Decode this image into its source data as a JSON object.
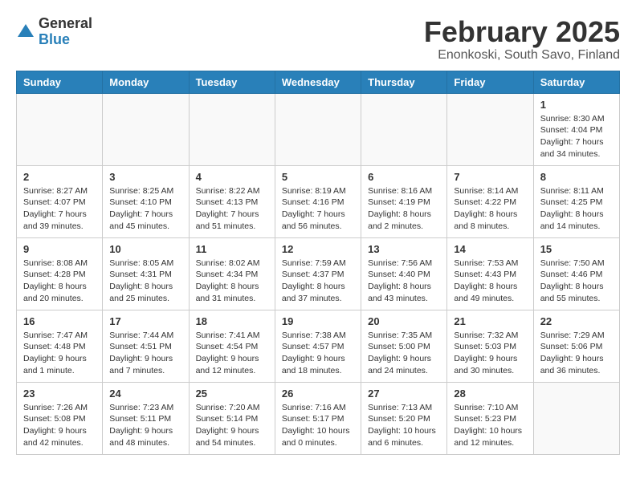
{
  "logo": {
    "general": "General",
    "blue": "Blue"
  },
  "title": "February 2025",
  "subtitle": "Enonkoski, South Savo, Finland",
  "weekdays": [
    "Sunday",
    "Monday",
    "Tuesday",
    "Wednesday",
    "Thursday",
    "Friday",
    "Saturday"
  ],
  "weeks": [
    [
      {
        "day": "",
        "info": ""
      },
      {
        "day": "",
        "info": ""
      },
      {
        "day": "",
        "info": ""
      },
      {
        "day": "",
        "info": ""
      },
      {
        "day": "",
        "info": ""
      },
      {
        "day": "",
        "info": ""
      },
      {
        "day": "1",
        "info": "Sunrise: 8:30 AM\nSunset: 4:04 PM\nDaylight: 7 hours\nand 34 minutes."
      }
    ],
    [
      {
        "day": "2",
        "info": "Sunrise: 8:27 AM\nSunset: 4:07 PM\nDaylight: 7 hours\nand 39 minutes."
      },
      {
        "day": "3",
        "info": "Sunrise: 8:25 AM\nSunset: 4:10 PM\nDaylight: 7 hours\nand 45 minutes."
      },
      {
        "day": "4",
        "info": "Sunrise: 8:22 AM\nSunset: 4:13 PM\nDaylight: 7 hours\nand 51 minutes."
      },
      {
        "day": "5",
        "info": "Sunrise: 8:19 AM\nSunset: 4:16 PM\nDaylight: 7 hours\nand 56 minutes."
      },
      {
        "day": "6",
        "info": "Sunrise: 8:16 AM\nSunset: 4:19 PM\nDaylight: 8 hours\nand 2 minutes."
      },
      {
        "day": "7",
        "info": "Sunrise: 8:14 AM\nSunset: 4:22 PM\nDaylight: 8 hours\nand 8 minutes."
      },
      {
        "day": "8",
        "info": "Sunrise: 8:11 AM\nSunset: 4:25 PM\nDaylight: 8 hours\nand 14 minutes."
      }
    ],
    [
      {
        "day": "9",
        "info": "Sunrise: 8:08 AM\nSunset: 4:28 PM\nDaylight: 8 hours\nand 20 minutes."
      },
      {
        "day": "10",
        "info": "Sunrise: 8:05 AM\nSunset: 4:31 PM\nDaylight: 8 hours\nand 25 minutes."
      },
      {
        "day": "11",
        "info": "Sunrise: 8:02 AM\nSunset: 4:34 PM\nDaylight: 8 hours\nand 31 minutes."
      },
      {
        "day": "12",
        "info": "Sunrise: 7:59 AM\nSunset: 4:37 PM\nDaylight: 8 hours\nand 37 minutes."
      },
      {
        "day": "13",
        "info": "Sunrise: 7:56 AM\nSunset: 4:40 PM\nDaylight: 8 hours\nand 43 minutes."
      },
      {
        "day": "14",
        "info": "Sunrise: 7:53 AM\nSunset: 4:43 PM\nDaylight: 8 hours\nand 49 minutes."
      },
      {
        "day": "15",
        "info": "Sunrise: 7:50 AM\nSunset: 4:46 PM\nDaylight: 8 hours\nand 55 minutes."
      }
    ],
    [
      {
        "day": "16",
        "info": "Sunrise: 7:47 AM\nSunset: 4:48 PM\nDaylight: 9 hours\nand 1 minute."
      },
      {
        "day": "17",
        "info": "Sunrise: 7:44 AM\nSunset: 4:51 PM\nDaylight: 9 hours\nand 7 minutes."
      },
      {
        "day": "18",
        "info": "Sunrise: 7:41 AM\nSunset: 4:54 PM\nDaylight: 9 hours\nand 12 minutes."
      },
      {
        "day": "19",
        "info": "Sunrise: 7:38 AM\nSunset: 4:57 PM\nDaylight: 9 hours\nand 18 minutes."
      },
      {
        "day": "20",
        "info": "Sunrise: 7:35 AM\nSunset: 5:00 PM\nDaylight: 9 hours\nand 24 minutes."
      },
      {
        "day": "21",
        "info": "Sunrise: 7:32 AM\nSunset: 5:03 PM\nDaylight: 9 hours\nand 30 minutes."
      },
      {
        "day": "22",
        "info": "Sunrise: 7:29 AM\nSunset: 5:06 PM\nDaylight: 9 hours\nand 36 minutes."
      }
    ],
    [
      {
        "day": "23",
        "info": "Sunrise: 7:26 AM\nSunset: 5:08 PM\nDaylight: 9 hours\nand 42 minutes."
      },
      {
        "day": "24",
        "info": "Sunrise: 7:23 AM\nSunset: 5:11 PM\nDaylight: 9 hours\nand 48 minutes."
      },
      {
        "day": "25",
        "info": "Sunrise: 7:20 AM\nSunset: 5:14 PM\nDaylight: 9 hours\nand 54 minutes."
      },
      {
        "day": "26",
        "info": "Sunrise: 7:16 AM\nSunset: 5:17 PM\nDaylight: 10 hours\nand 0 minutes."
      },
      {
        "day": "27",
        "info": "Sunrise: 7:13 AM\nSunset: 5:20 PM\nDaylight: 10 hours\nand 6 minutes."
      },
      {
        "day": "28",
        "info": "Sunrise: 7:10 AM\nSunset: 5:23 PM\nDaylight: 10 hours\nand 12 minutes."
      },
      {
        "day": "",
        "info": ""
      }
    ]
  ]
}
